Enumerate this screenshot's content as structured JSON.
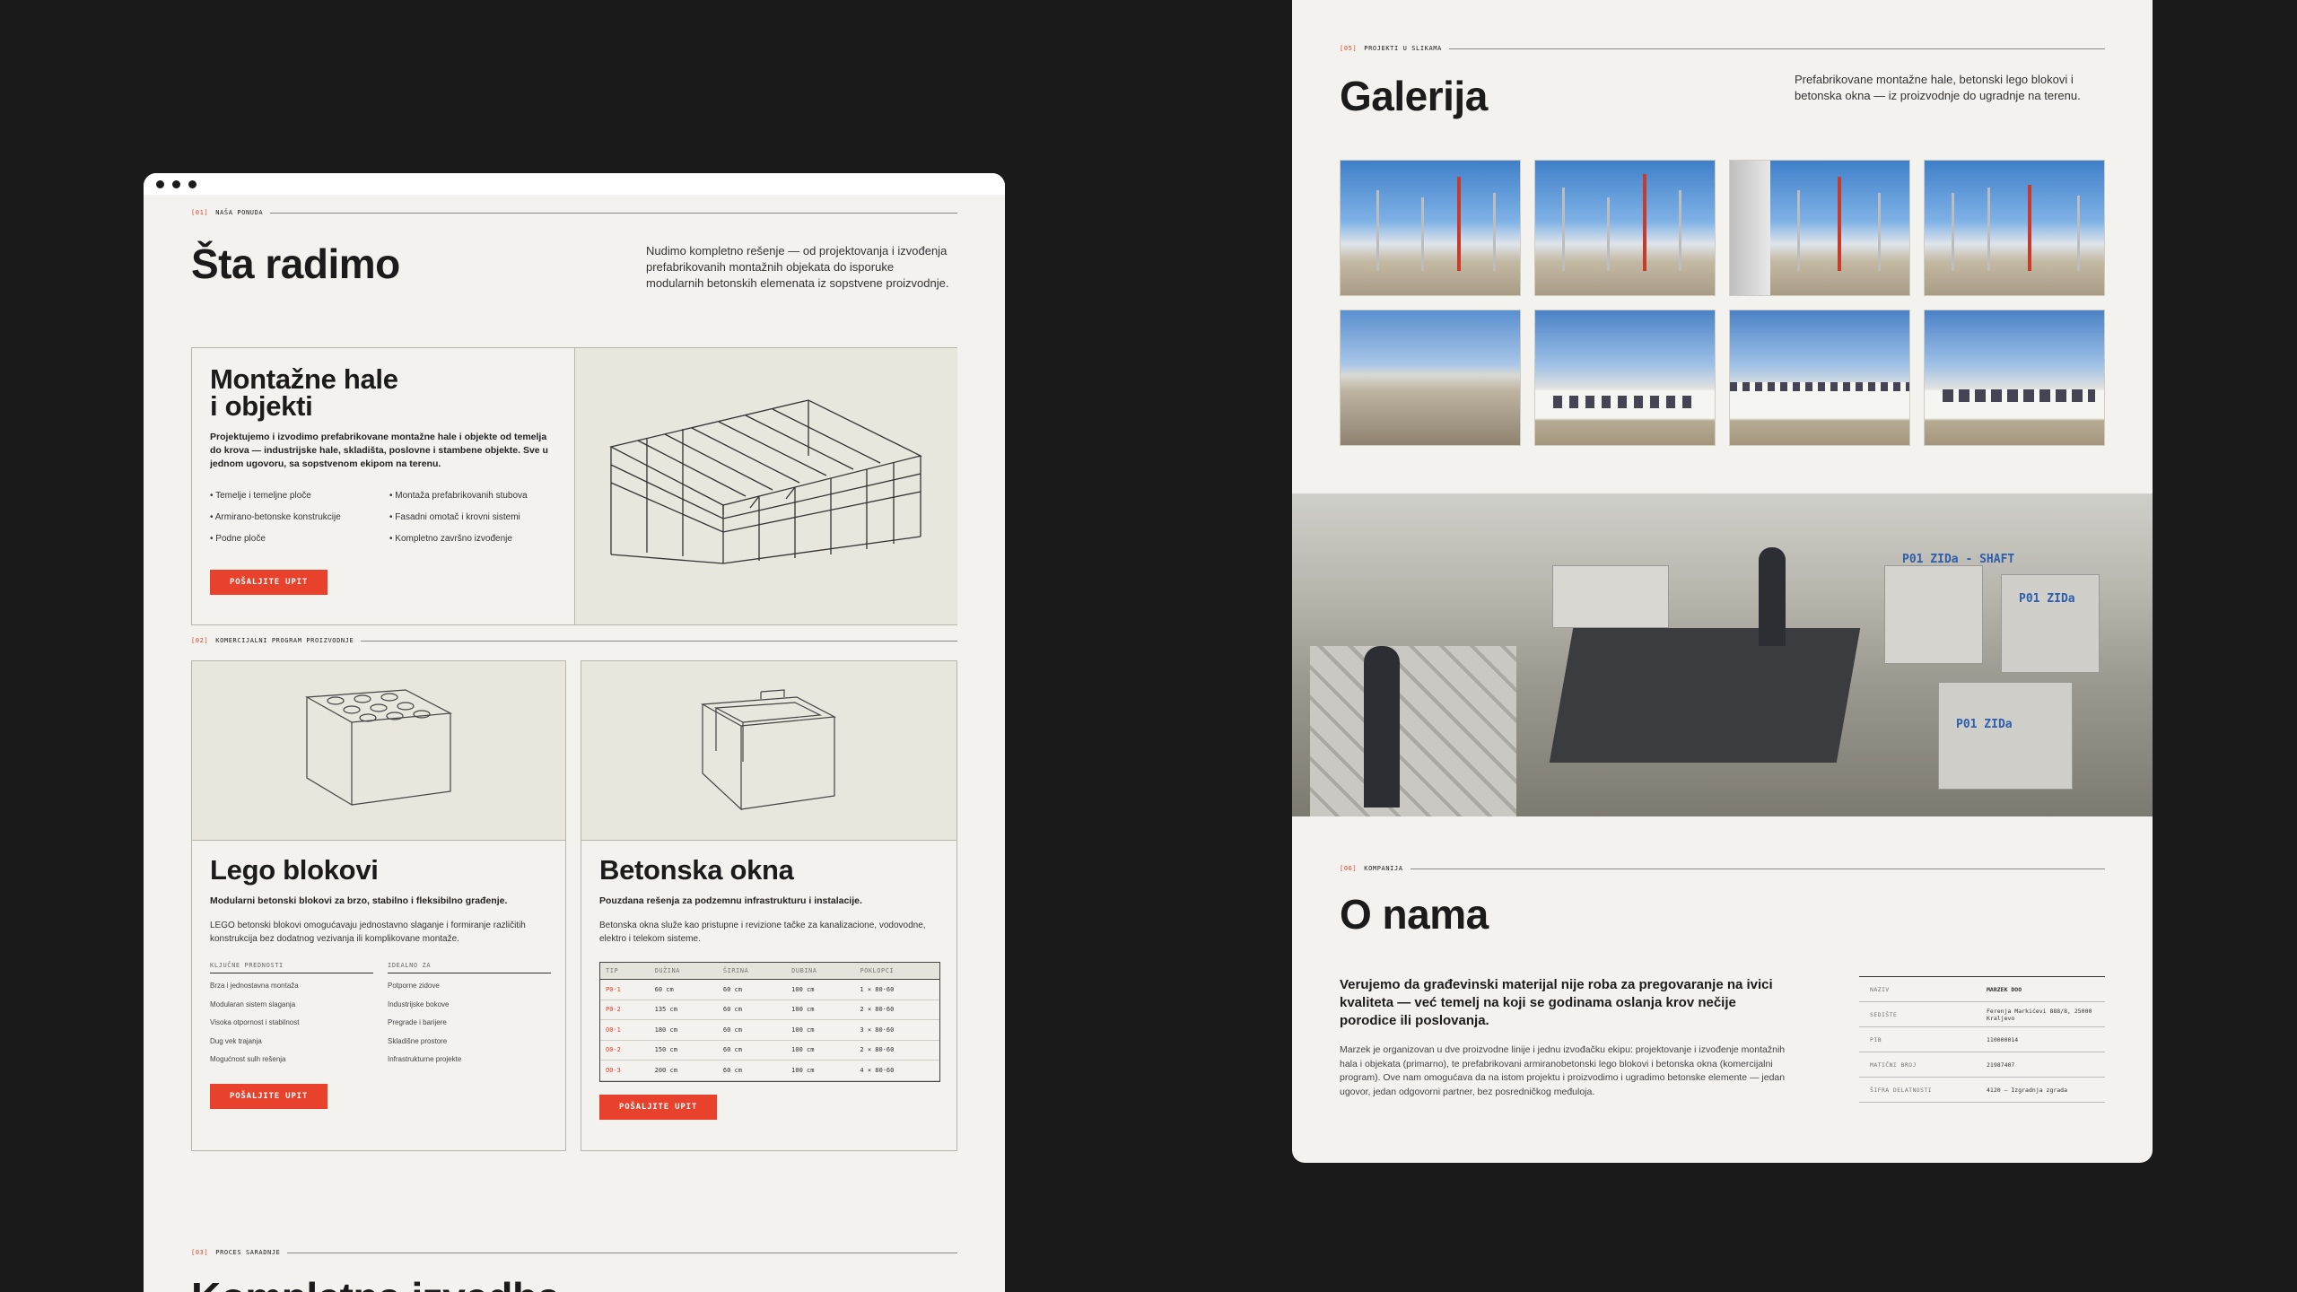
{
  "left": {
    "s1": {
      "num": "[01]",
      "label": "NAŠA PONUDA",
      "title": "Šta radimo",
      "lead": "Nudimo kompletno rešenje — od projektovanja i izvođenja prefabrikovanih montažnih objekata do isporuke modularnih betonskih elemenata iz sopstvene proizvodnje."
    },
    "card1": {
      "title_l1": "Montažne hale",
      "title_l2": "i objekti",
      "desc": "Projektujemo i izvodimo prefabrikovane montažne hale i objekte od temelja do krova — industrijske hale, skladišta, poslovne i stambene objekte. Sve u jednom ugovoru, sa sopstvenom ekipom na terenu.",
      "bullets_a": [
        "Temelje i temeljne ploče",
        "Armirano-betonske konstrukcije",
        "Podne ploče"
      ],
      "bullets_b": [
        "Montaža prefabrikovanih stubova",
        "Fasadni omotač i krovni sistemi",
        "Kompletno završno izvođenje"
      ],
      "button": "POŠALJITE UPIT"
    },
    "s2": {
      "num": "[02]",
      "label": "KOMERCIJALNI PROGRAM PROIZVODNJE"
    },
    "card2": {
      "title": "Lego blokovi",
      "sub": "Modularni betonski blokovi za brzo, stabilno i fleksibilno građenje.",
      "desc": "LEGO betonski blokovi omogućavaju jednostavno slaganje i formiranje različitih konstrukcija bez dodatnog vezivanja ili komplikovane montaže.",
      "head_a": "KLJUČNE PREDNOSTI",
      "head_b": "IDEALNO ZA",
      "list_a": [
        "Brza i jednostavna montaža",
        "Modularan sistem slaganja",
        "Visoka otpornost i stabilnost",
        "Dug vek trajanja",
        "Mogućnost sulh rešenja"
      ],
      "list_b": [
        "Potporne zidove",
        "Industrijske bokove",
        "Pregrade i barijere",
        "Skladišne prostore",
        "Infrastrukturne projekte"
      ],
      "button": "POŠALJITE UPIT"
    },
    "card3": {
      "title": "Betonska okna",
      "sub": "Pouzdana rešenja za podzemnu infrastrukturu i instalacije.",
      "desc": "Betonska okna služe kao pristupne i revizione tačke za kanalizacione, vodovodne, elektro i telekom sisteme.",
      "cols": [
        "TIP",
        "DUŽINA",
        "ŠIRINA",
        "DUBINA",
        "POKLOPCI"
      ],
      "rows": [
        [
          "P0-1",
          "60 cm",
          "60 cm",
          "100 cm",
          "1 × 80·60"
        ],
        [
          "P0-2",
          "135 cm",
          "60 cm",
          "100 cm",
          "2 × 80·60"
        ],
        [
          "O0-1",
          "180 cm",
          "60 cm",
          "100 cm",
          "3 × 80·60"
        ],
        [
          "O0-2",
          "150 cm",
          "60 cm",
          "100 cm",
          "2 × 80·60"
        ],
        [
          "O0-3",
          "200 cm",
          "60 cm",
          "100 cm",
          "4 × 80·60"
        ]
      ],
      "button": "POŠALJITE UPIT"
    },
    "s3": {
      "num": "[03]",
      "label": "PROCES SARADNJE",
      "title_partial": "Kompletna izvedba"
    }
  },
  "right": {
    "s5": {
      "num": "[05]",
      "label": "PROJEKTI U SLIKAMA",
      "title": "Galerija",
      "lead": "Prefabrikovane montažne hale, betonski lego blokovi i betonska okna — iz proizvodnje do ugradnje na terenu."
    },
    "s6": {
      "num": "[06]",
      "label": "KOMPANIJA",
      "title": "O nama",
      "lead": "Verujemo da građevinski materijal nije roba za pregovaranje na ivici kvaliteta — već temelj na koji se godinama oslanja krov nečije porodice ili poslovanja.",
      "body": "Marzek je organizovan u dve proizvodne linije i jednu izvođačku ekipu: projektovanje i izvođenje montažnih hala i objekata (primarno), te prefabrikovani armiranobetonski lego blokovi i betonska okna (komercijalni program). Ove nam omogućava da na istom projektu i proizvodimo i ugradimo betonske elemente — jedan ugovor, jedan odgovorni partner, bez posredničkog međuloja.",
      "info": [
        [
          "NAZIV",
          "MARZEK DOO"
        ],
        [
          "SEDIŠTE",
          "Ferenja Markićevi 888/8, 25000 Kraljevo"
        ],
        [
          "PIB",
          "110000014"
        ],
        [
          "MATIČNI BROJ",
          "21987407"
        ],
        [
          "ŠIFRA DELATNOSTI",
          "4120 — Izgradnja zgrada"
        ]
      ],
      "photo_text": [
        "P01 ZIDa - SHAFT",
        "P01 ZIDa",
        "P01 ZIDa"
      ]
    }
  }
}
